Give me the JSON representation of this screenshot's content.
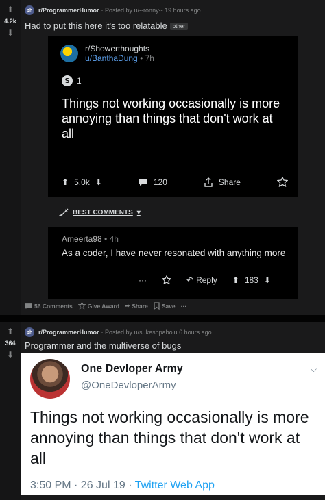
{
  "post1": {
    "score": "4.2k",
    "subreddit": "r/ProgrammerHumor",
    "posted_by": "· Posted by u/--ronny-- 19 hours ago",
    "title": "Had to put this here it's too relatable",
    "flair": "other",
    "screenshot": {
      "subreddit": "r/Showerthoughts",
      "user": "u/BanthaDung",
      "time": " • 7h",
      "award_count": "1",
      "title": "Things not working occasionally is more annoying than things that don't work at all",
      "upvotes": "5.0k",
      "comments": "120",
      "share": "Share",
      "best_comments": "BEST COMMENTS",
      "comment": {
        "author": "Ameerta98",
        "time": " • 4h",
        "body": "As a coder, I have never resonated with anything more",
        "more": "···",
        "reply": "Reply",
        "score": "183"
      }
    },
    "footer": {
      "comments": "56 Comments",
      "give_award": "Give Award",
      "share": "Share",
      "save": "Save",
      "more": "···"
    }
  },
  "post2": {
    "score": "364",
    "subreddit": "r/ProgrammerHumor",
    "posted_by": "· Posted by u/sukeshpabolu 6 hours ago",
    "title": "Programmer and the multiverse of bugs",
    "tweet": {
      "name": "One Devloper Army",
      "handle": "@OneDevloperArmy",
      "text": "Things not working occasionally is more annoying than things that don't work at all",
      "time": "3:50 PM · 26 Jul 19 · ",
      "source": "Twitter Web App"
    }
  }
}
